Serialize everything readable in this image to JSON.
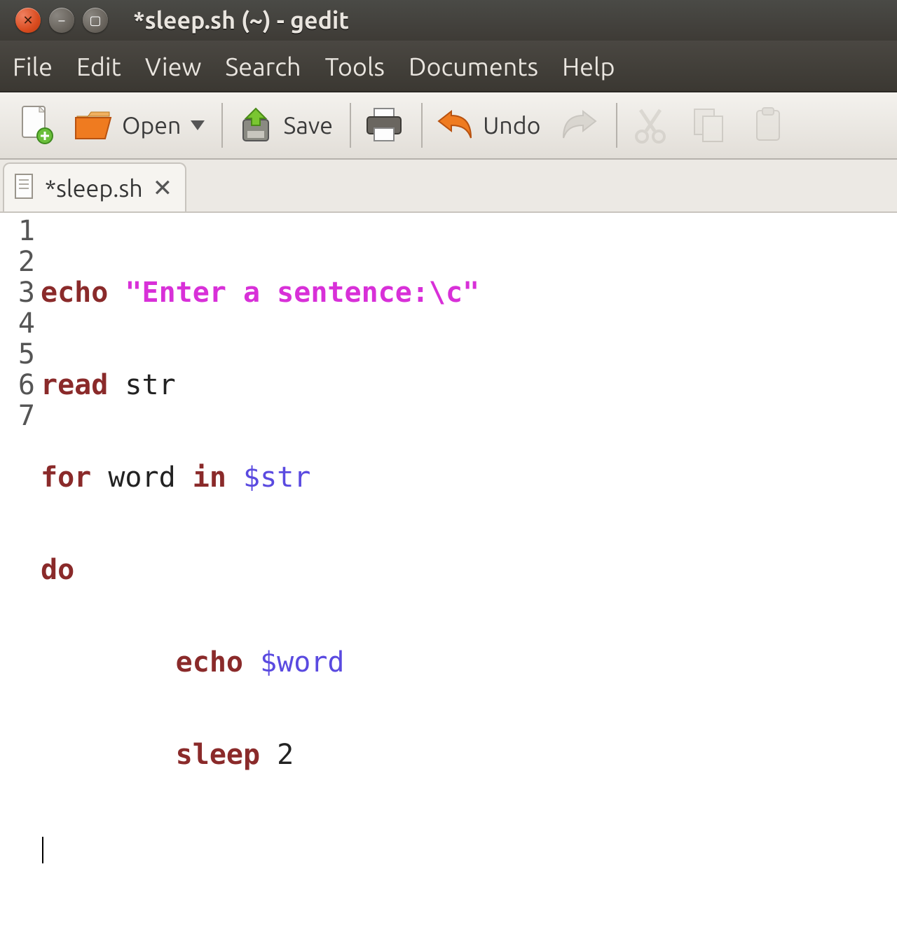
{
  "window": {
    "title": "*sleep.sh (~) - gedit"
  },
  "menu": {
    "file": "File",
    "edit": "Edit",
    "view": "View",
    "search": "Search",
    "tools": "Tools",
    "documents": "Documents",
    "help": "Help"
  },
  "toolbar": {
    "open": "Open",
    "save": "Save",
    "undo": "Undo"
  },
  "tab": {
    "label": "*sleep.sh"
  },
  "gutter": {
    "l1": "1",
    "l2": "2",
    "l3": "3",
    "l4": "4",
    "l5": "5",
    "l6": "6",
    "l7": "7"
  },
  "code": {
    "l1": {
      "t1": "echo",
      "t2": "\"Enter a sentence:\\c\""
    },
    "l2": {
      "t1": "read",
      "t2": "str"
    },
    "l3": {
      "t1": "for",
      "t2": "word",
      "t3": "in",
      "t4": "$str"
    },
    "l4": {
      "t1": "do"
    },
    "l5": {
      "t1": "echo",
      "t2": "$word"
    },
    "l6": {
      "t1": "sleep",
      "t2": "2"
    },
    "l7": {
      "t1": ""
    }
  }
}
